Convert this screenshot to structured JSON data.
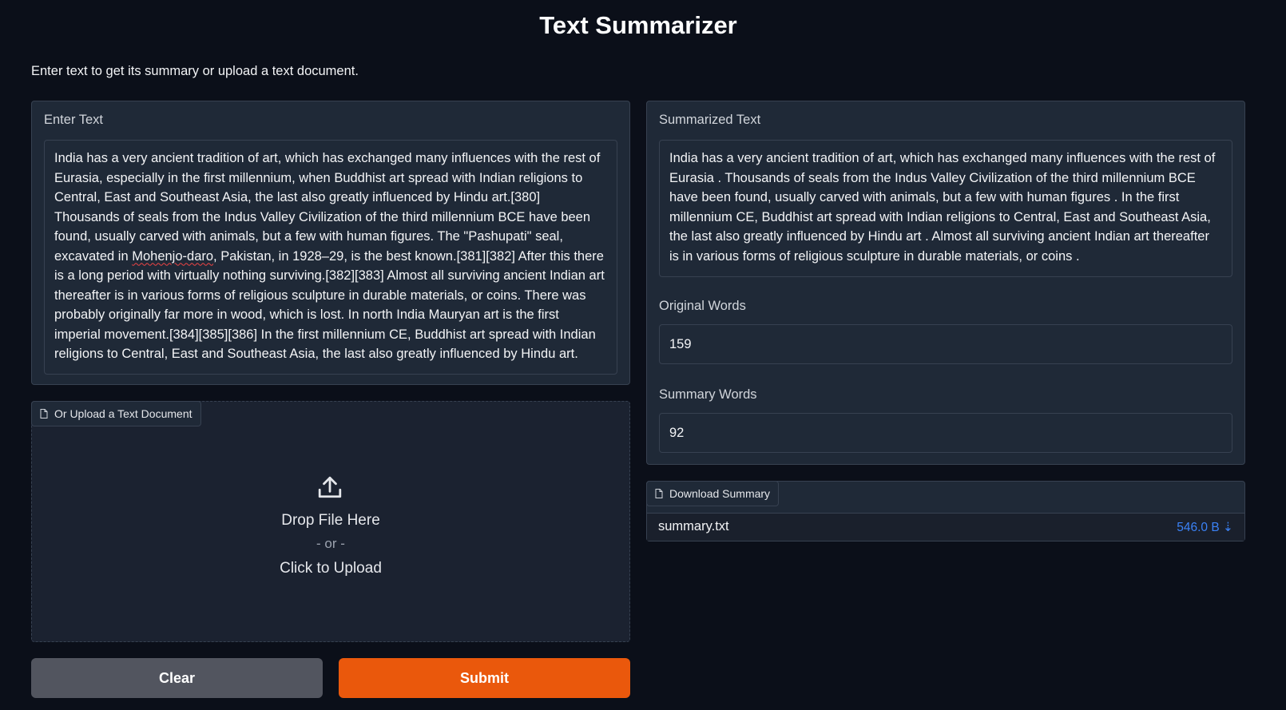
{
  "header": {
    "title": "Text Summarizer",
    "description": "Enter text to get its summary or upload a text document."
  },
  "input": {
    "label": "Enter Text",
    "text_before": "India has a very ancient tradition of art, which has exchanged many influences with the rest of Eurasia, especially in the first millennium, when Buddhist art spread with Indian religions to Central, East and Southeast Asia, the last also greatly influenced by Hindu art.[380] Thousands of seals from the Indus Valley Civilization of the third millennium BCE have been found, usually carved with animals, but a few with human figures. The \"Pashupati\" seal, excavated in ",
    "text_misspelled": "Mohenjo-daro",
    "text_after": ", Pakistan, in 1928–29, is the best known.[381][382] After this there is a long period with virtually nothing surviving.[382][383] Almost all surviving ancient Indian art thereafter is in various forms of religious sculpture in durable materials, or coins. There was probably originally far more in wood, which is lost. In north India Mauryan art is the first imperial movement.[384][385][386] In the first millennium CE, Buddhist art spread with Indian religions to Central, East and Southeast Asia, the last also greatly influenced by Hindu art."
  },
  "upload": {
    "tab_label": "Or Upload a Text Document",
    "drop_text": "Drop File Here",
    "or_text": "- or -",
    "click_text": "Click to Upload"
  },
  "buttons": {
    "clear": "Clear",
    "submit": "Submit"
  },
  "output": {
    "summary_label": "Summarized Text",
    "summary_text": "India has a very ancient tradition of art, which has exchanged many influences with the rest of Eurasia . Thousands of seals from the Indus Valley Civilization of the third millennium BCE have been found, usually carved with animals, but a few with human figures . In the first millennium CE, Buddhist art spread with Indian religions to Central, East and Southeast Asia, the last also greatly influenced by Hindu art . Almost all surviving ancient Indian art thereafter is in various forms of religious sculpture in durable materials, or coins .",
    "original_words_label": "Original Words",
    "original_words_value": "159",
    "summary_words_label": "Summary Words",
    "summary_words_value": "92"
  },
  "download": {
    "tab_label": "Download Summary",
    "file_name": "summary.txt",
    "file_size": "546.0 B",
    "download_glyph": "⇣"
  },
  "colors": {
    "background": "#0b0f19",
    "panel": "#1f2937",
    "border": "#374151",
    "submit": "#ea580c",
    "clear": "#4b5563",
    "link": "#3b82f6"
  }
}
